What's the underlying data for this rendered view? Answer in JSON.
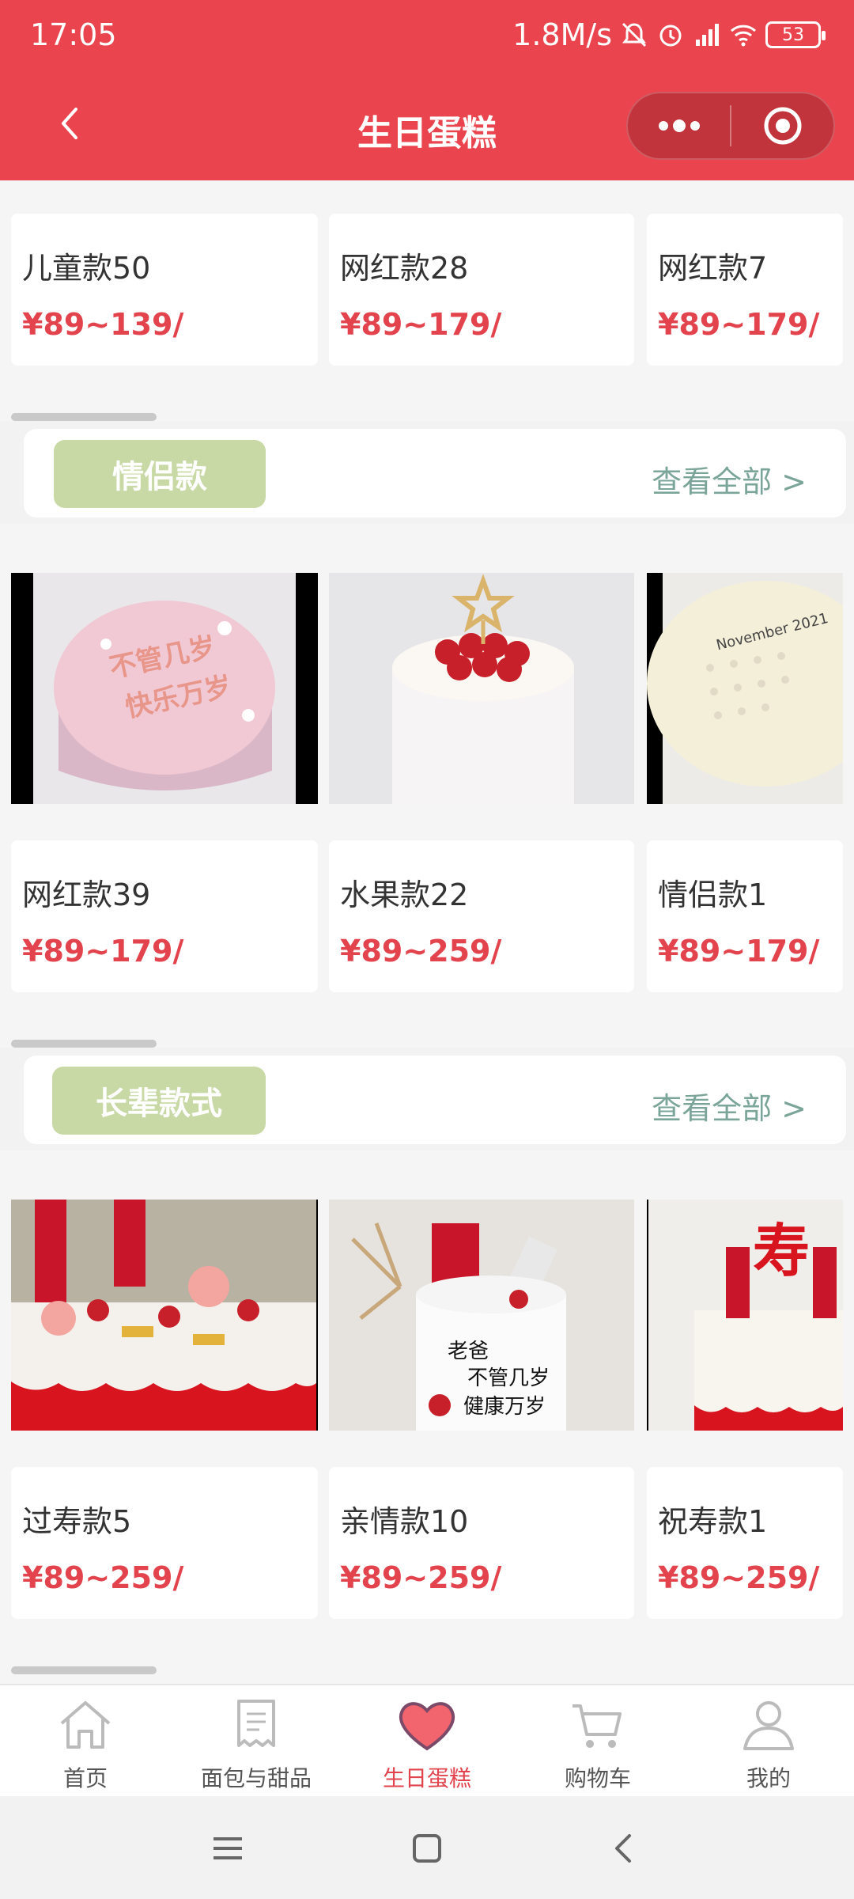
{
  "status_bar": {
    "time": "17:05",
    "network_speed": "1.8M/s",
    "battery": "53",
    "icons": [
      "mute-bell-icon",
      "alarm-icon",
      "hd-signal-icon",
      "wifi-icon",
      "battery-icon"
    ]
  },
  "header": {
    "title": "生日蛋糕",
    "back_icon": "back-arrow-icon",
    "capsule_icons": [
      "more-dots-icon",
      "target-icon"
    ],
    "background": "#ea454e"
  },
  "top_row": [
    {
      "name": "儿童款50",
      "price": "¥89~139/"
    },
    {
      "name": "网红款28",
      "price": "¥89~179/"
    },
    {
      "name": "网红款7",
      "price": "¥89~179/"
    }
  ],
  "sections": [
    {
      "tag": "情侣款",
      "more": "查看全部 >",
      "products": [
        {
          "name": "网红款39",
          "price": "¥89~179/",
          "image_text": "不管几岁 快乐万岁"
        },
        {
          "name": "水果款22",
          "price": "¥89~259/",
          "image_text": ""
        },
        {
          "name": "情侣款1",
          "price": "¥89~179/",
          "image_text": "November 2021"
        }
      ]
    },
    {
      "tag": "长辈款式",
      "more": "查看全部 >",
      "products": [
        {
          "name": "过寿款5",
          "price": "¥89~259/",
          "image_text": ""
        },
        {
          "name": "亲情款10",
          "price": "¥89~259/",
          "image_text": "老爸 不管几岁 健康万岁"
        },
        {
          "name": "祝寿款1",
          "price": "¥89~259/",
          "image_text": "寿"
        }
      ]
    }
  ],
  "tabbar": [
    {
      "label": "首页",
      "icon": "home-icon",
      "active": false
    },
    {
      "label": "面包与甜品",
      "icon": "receipt-icon",
      "active": false
    },
    {
      "label": "生日蛋糕",
      "icon": "heart-icon",
      "active": true
    },
    {
      "label": "购物车",
      "icon": "cart-icon",
      "active": false
    },
    {
      "label": "我的",
      "icon": "user-icon",
      "active": false
    }
  ],
  "colors": {
    "accent": "#e2434c",
    "tag_bg": "#c8d9a6",
    "more_link": "#7aa598"
  }
}
